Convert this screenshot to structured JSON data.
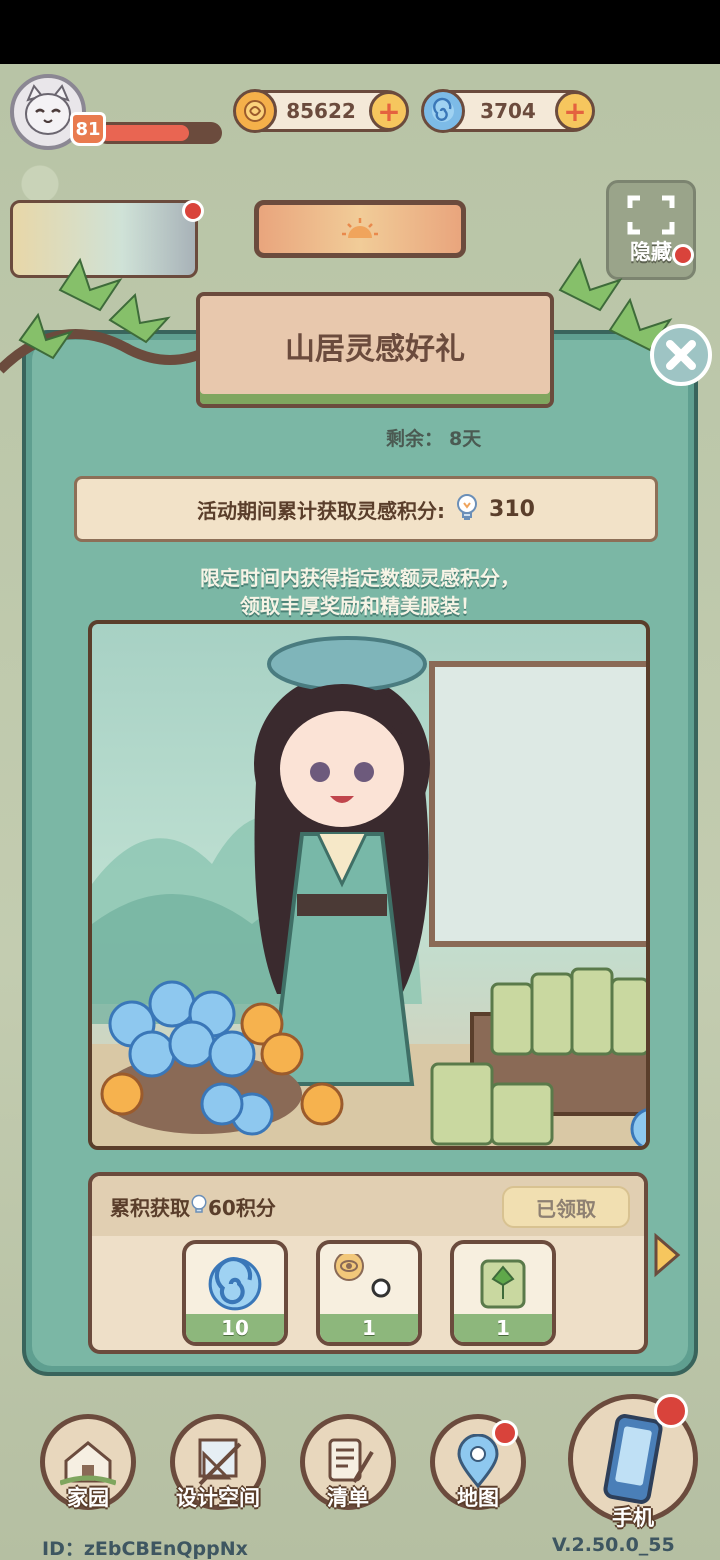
{
  "header": {
    "level": "81",
    "xp_progress": 0.75,
    "coins": "85622",
    "gems": "3704",
    "hide_label": "隐藏"
  },
  "event": {
    "title": "山居灵感好礼",
    "remaining_label": "剩余：",
    "remaining_value": "8天",
    "score_label": "活动期间累计获取灵感积分:",
    "score_value": "310",
    "desc_line1": "限定时间内获得指定数额灵感积分，",
    "desc_line2": "领取丰厚奖励和精美服装！"
  },
  "reward_tier": {
    "label_prefix": "累积获取",
    "label_suffix": "60积分",
    "status": "已领取",
    "items": [
      {
        "icon": "spiral-gem-icon",
        "qty": "10"
      },
      {
        "icon": "orb-item-icon",
        "qty": "1"
      },
      {
        "icon": "leaf-scroll-icon",
        "qty": "1"
      }
    ]
  },
  "nav": {
    "items": [
      {
        "label": "家园",
        "icon": "house-icon"
      },
      {
        "label": "设计空间",
        "icon": "design-tools-icon"
      },
      {
        "label": "清单",
        "icon": "checklist-icon"
      },
      {
        "label": "地图",
        "icon": "map-pin-icon"
      },
      {
        "label": "手机",
        "icon": "phone-icon"
      }
    ]
  },
  "footer": {
    "id_text": "ID：zEbCBEnQppNx",
    "version": "V.2.50.0_55"
  },
  "colors": {
    "panel": "#7bb7a5",
    "frame": "#6b4b3d",
    "coin": "#f5b04a",
    "gem": "#7dbbe7",
    "badge": "#e97b4f"
  }
}
